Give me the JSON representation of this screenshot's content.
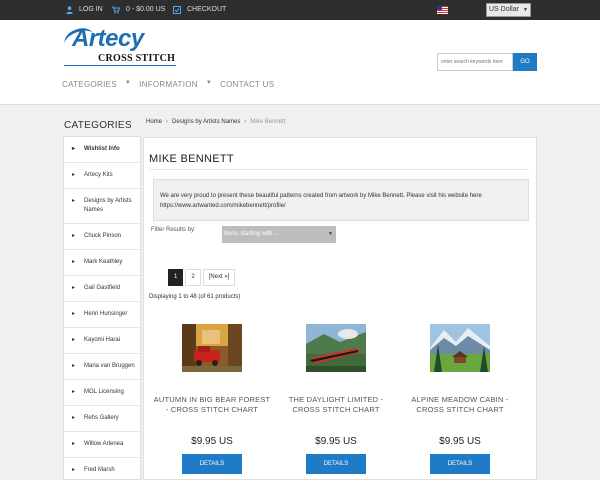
{
  "topbar": {
    "login": "LOG IN",
    "cart": "0 - $0.00 US",
    "checkout": "CHECKOUT",
    "currency": "US Dollar"
  },
  "header": {
    "logo_brand": "Artecy",
    "logo_sub": "CROSS STITCH",
    "search_placeholder": "enter search keywords here",
    "search_button": "GO",
    "nav": [
      "CATEGORIES",
      "INFORMATION",
      "CONTACT US"
    ]
  },
  "sidebar": {
    "title": "CATEGORIES",
    "items": [
      "Wishlist Info",
      "Artecy Kits",
      "Designs by Artists Names",
      "Chuck Pinson",
      "Mark Keathley",
      "Gail Gastfield",
      "Henri Hunsinger",
      "Kayomi Harai",
      "Maria van Bruggen",
      "MGL Licensing",
      "Rehs Gallery",
      "Willow Arlenea",
      "Fred Marsh"
    ]
  },
  "breadcrumb": [
    "Home",
    "Designs by Artists Names",
    "Mike Bennett"
  ],
  "main": {
    "title": "MIKE BENNETT",
    "description": "We are very proud to present these beautiful patterns created from artwork by Mike Bennett. Please visit his website here https://www.artwanted.com/mikebennett/profile/",
    "filter_label": "Filter Results by:",
    "filter_value": "Items starting with ...",
    "pages": [
      "1",
      "2",
      "[Next »]"
    ],
    "display_count": "Displaying 1 to 48 (of 61 products)"
  },
  "products": [
    {
      "name": "AUTUMN IN BIG BEAR FOREST - CROSS STITCH CHART",
      "price": "$9.95 US",
      "button": "DETAILS"
    },
    {
      "name": "THE DAYLIGHT LIMITED - CROSS STITCH CHART",
      "price": "$9.95 US",
      "button": "DETAILS"
    },
    {
      "name": "ALPINE MEADOW CABIN - CROSS STITCH CHART",
      "price": "$9.95 US",
      "button": "DETAILS"
    }
  ],
  "colors": {
    "accent": "#1f7bc6",
    "topbar": "#2e2e2e"
  },
  "icons": {
    "login": "user-icon",
    "cart": "cart-icon",
    "checkout": "checkout-icon",
    "flag": "us-flag-icon"
  }
}
